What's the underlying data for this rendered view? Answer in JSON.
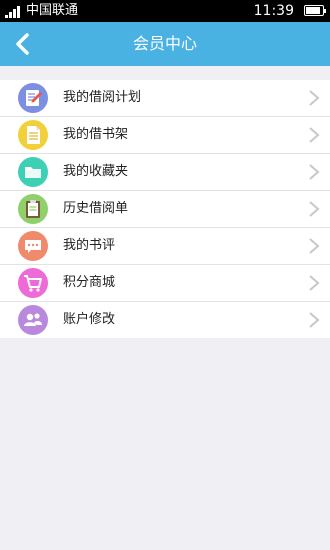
{
  "status_bar": {
    "carrier": "中国联通",
    "time": "11:39",
    "battery_level": 0.85,
    "signal_bars": 4
  },
  "header": {
    "title": "会员中心",
    "back_icon": "back-chevron-icon",
    "color": "#49b2e3"
  },
  "menu": {
    "items": [
      {
        "label": "我的借阅计划",
        "icon": "edit-note-icon",
        "color": "#7d8fe0"
      },
      {
        "label": "我的借书架",
        "icon": "document-icon",
        "color": "#f1d03a"
      },
      {
        "label": "我的收藏夹",
        "icon": "folder-icon",
        "color": "#3dd0b5"
      },
      {
        "label": "历史借阅单",
        "icon": "clipboard-icon",
        "color": "#8fd06a"
      },
      {
        "label": "我的书评",
        "icon": "comment-icon",
        "color": "#f08a6c"
      },
      {
        "label": "积分商城",
        "icon": "shopping-cart-icon",
        "color": "#ee6ad6"
      },
      {
        "label": "账户修改",
        "icon": "users-icon",
        "color": "#b889dc"
      }
    ]
  }
}
